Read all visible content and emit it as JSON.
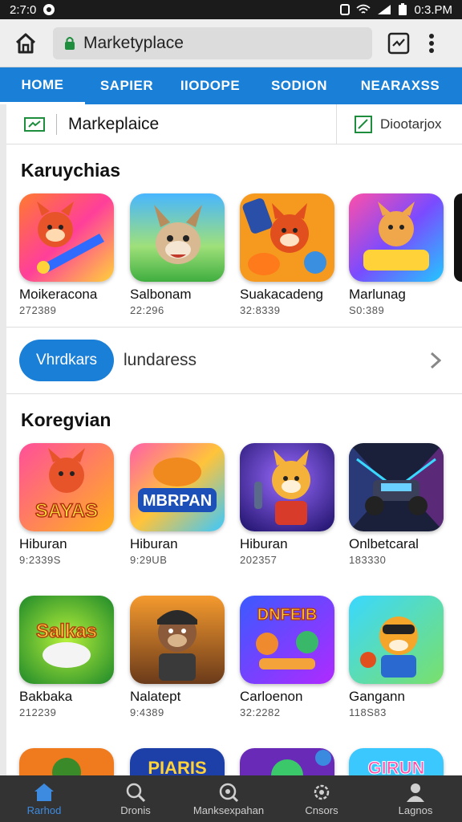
{
  "status": {
    "time": "2:7:0",
    "clock": "0:3.PM"
  },
  "browser": {
    "url": "Marketyplace"
  },
  "nav_tabs": [
    {
      "label": "HOME",
      "active": true
    },
    {
      "label": "SAPIER",
      "active": false
    },
    {
      "label": "IIODOPE",
      "active": false
    },
    {
      "label": "SODION",
      "active": false
    },
    {
      "label": "NEARAXSS",
      "active": false
    }
  ],
  "sub_header": {
    "title": "Markeplaice",
    "right_label": "Diootarjox"
  },
  "section1": {
    "title": "Karuychias",
    "apps": [
      {
        "name": "Moikeracona",
        "sub": "272389"
      },
      {
        "name": "Salbonam",
        "sub": "22:296"
      },
      {
        "name": "Suakacadeng",
        "sub": "32:8339"
      },
      {
        "name": "Marlunag",
        "sub": "S0:389"
      }
    ]
  },
  "promo": {
    "pill": "Vhrdkars",
    "label": "lundaress"
  },
  "section2": {
    "title": "Koregvian",
    "apps": [
      {
        "name": "Hiburan",
        "sub": "9:2339S",
        "art": "SAYAS"
      },
      {
        "name": "Hiburan",
        "sub": "9:29UB",
        "art": "MBRPAN"
      },
      {
        "name": "Hiburan",
        "sub": "202357",
        "art": ""
      },
      {
        "name": "Onlbetcaral",
        "sub": "183330",
        "art": ""
      }
    ]
  },
  "section3": {
    "apps": [
      {
        "name": "Bakbaka",
        "sub": "212239",
        "art": "Salkas"
      },
      {
        "name": "Nalatept",
        "sub": "9:4389",
        "art": ""
      },
      {
        "name": "Carloenon",
        "sub": "32:2282",
        "art": "DNFEIB"
      },
      {
        "name": "Gangann",
        "sub": "118S83",
        "art": ""
      }
    ]
  },
  "section4": {
    "arts": [
      "",
      "PIARIS",
      "",
      "GIRUN"
    ]
  },
  "bottom_nav": [
    {
      "label": "Rarhod",
      "icon": "home-icon",
      "active": true
    },
    {
      "label": "Dronis",
      "icon": "search-icon",
      "active": false
    },
    {
      "label": "Manksexpahan",
      "icon": "magnifier-icon",
      "active": false
    },
    {
      "label": "Cnsors",
      "icon": "settings-icon",
      "active": false
    },
    {
      "label": "Lagnos",
      "icon": "person-icon",
      "active": false
    }
  ]
}
